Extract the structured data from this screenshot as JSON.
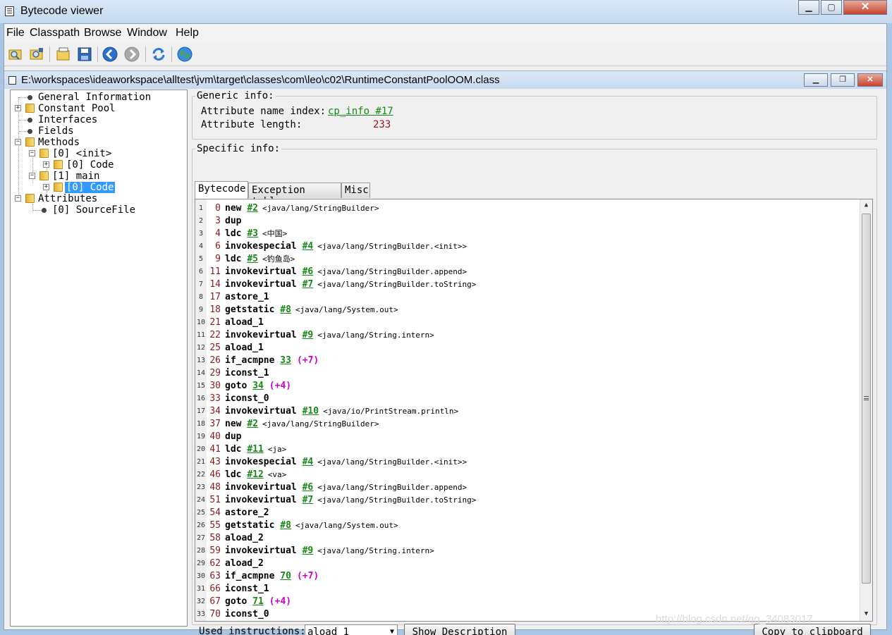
{
  "window": {
    "title": "Bytecode viewer",
    "minimize": "▁",
    "maximize": "▢",
    "close": "✕"
  },
  "menu": [
    "File",
    "Classpath",
    "Browse",
    "Window",
    "Help"
  ],
  "toolbar": {
    "icons": [
      "open-class-icon",
      "open-jar-icon",
      "browse-classpath-icon",
      "save-icon",
      "back-icon",
      "forward-icon",
      "reload-icon",
      "web-icon"
    ]
  },
  "inner_window": {
    "path": "E:\\workspaces\\ideaworkspace\\alltest\\jvm\\target\\classes\\com\\leo\\c02\\RuntimeConstantPoolOOM.class",
    "minimize": "▁",
    "restore": "❐",
    "close": "✕"
  },
  "tree": [
    {
      "label": "General Information",
      "kind": "leaf",
      "depth": 0
    },
    {
      "label": "Constant Pool",
      "kind": "folder",
      "depth": 0,
      "expanded": false
    },
    {
      "label": "Interfaces",
      "kind": "leaf",
      "depth": 0
    },
    {
      "label": "Fields",
      "kind": "leaf",
      "depth": 0
    },
    {
      "label": "Methods",
      "kind": "folder",
      "depth": 0,
      "expanded": true
    },
    {
      "label": "[0] <init>",
      "kind": "folder",
      "depth": 1,
      "expanded": true
    },
    {
      "label": "[0] Code",
      "kind": "folder",
      "depth": 2,
      "expanded": false
    },
    {
      "label": "[1] main",
      "kind": "folder",
      "depth": 1,
      "expanded": true
    },
    {
      "label": "[0] Code",
      "kind": "folder",
      "depth": 2,
      "expanded": false,
      "selected": true
    },
    {
      "label": "Attributes",
      "kind": "folder",
      "depth": 0,
      "expanded": true
    },
    {
      "label": "[0] SourceFile",
      "kind": "leaf",
      "depth": 1
    }
  ],
  "generic": {
    "title": "Generic info:",
    "name_index_label": "Attribute name index:",
    "name_index_value": "cp_info #17",
    "length_label": "Attribute length:",
    "length_value": "233"
  },
  "specific": {
    "title": "Specific info:",
    "tabs": [
      "Bytecode",
      "Exception table",
      "Misc"
    ]
  },
  "bytecode": [
    {
      "ln": "1",
      "off": "0",
      "op": "new",
      "ref": "#2",
      "cmt": "<java/lang/StringBuilder>"
    },
    {
      "ln": "2",
      "off": "3",
      "op": "dup"
    },
    {
      "ln": "3",
      "off": "4",
      "op": "ldc",
      "ref": "#3",
      "cmt": "<中国>"
    },
    {
      "ln": "4",
      "off": "6",
      "op": "invokespecial",
      "ref": "#4",
      "cmt": "<java/lang/StringBuilder.<init>>"
    },
    {
      "ln": "5",
      "off": "9",
      "op": "ldc",
      "ref": "#5",
      "cmt": "<钓鱼岛>"
    },
    {
      "ln": "6",
      "off": "11",
      "op": "invokevirtual",
      "ref": "#6",
      "cmt": "<java/lang/StringBuilder.append>"
    },
    {
      "ln": "7",
      "off": "14",
      "op": "invokevirtual",
      "ref": "#7",
      "cmt": "<java/lang/StringBuilder.toString>"
    },
    {
      "ln": "8",
      "off": "17",
      "op": "astore_1"
    },
    {
      "ln": "9",
      "off": "18",
      "op": "getstatic",
      "ref": "#8",
      "cmt": "<java/lang/System.out>"
    },
    {
      "ln": "10",
      "off": "21",
      "op": "aload_1"
    },
    {
      "ln": "11",
      "off": "22",
      "op": "invokevirtual",
      "ref": "#9",
      "cmt": "<java/lang/String.intern>"
    },
    {
      "ln": "12",
      "off": "25",
      "op": "aload_1"
    },
    {
      "ln": "13",
      "off": "26",
      "op": "if_acmpne",
      "ref": "33",
      "jmp": "(+7)"
    },
    {
      "ln": "14",
      "off": "29",
      "op": "iconst_1"
    },
    {
      "ln": "15",
      "off": "30",
      "op": "goto",
      "ref": "34",
      "jmp": "(+4)"
    },
    {
      "ln": "16",
      "off": "33",
      "op": "iconst_0"
    },
    {
      "ln": "17",
      "off": "34",
      "op": "invokevirtual",
      "ref": "#10",
      "cmt": "<java/io/PrintStream.println>"
    },
    {
      "ln": "18",
      "off": "37",
      "op": "new",
      "ref": "#2",
      "cmt": "<java/lang/StringBuilder>"
    },
    {
      "ln": "19",
      "off": "40",
      "op": "dup"
    },
    {
      "ln": "20",
      "off": "41",
      "op": "ldc",
      "ref": "#11",
      "cmt": "<ja>"
    },
    {
      "ln": "21",
      "off": "43",
      "op": "invokespecial",
      "ref": "#4",
      "cmt": "<java/lang/StringBuilder.<init>>"
    },
    {
      "ln": "22",
      "off": "46",
      "op": "ldc",
      "ref": "#12",
      "cmt": "<va>"
    },
    {
      "ln": "23",
      "off": "48",
      "op": "invokevirtual",
      "ref": "#6",
      "cmt": "<java/lang/StringBuilder.append>"
    },
    {
      "ln": "24",
      "off": "51",
      "op": "invokevirtual",
      "ref": "#7",
      "cmt": "<java/lang/StringBuilder.toString>"
    },
    {
      "ln": "25",
      "off": "54",
      "op": "astore_2"
    },
    {
      "ln": "26",
      "off": "55",
      "op": "getstatic",
      "ref": "#8",
      "cmt": "<java/lang/System.out>"
    },
    {
      "ln": "27",
      "off": "58",
      "op": "aload_2"
    },
    {
      "ln": "28",
      "off": "59",
      "op": "invokevirtual",
      "ref": "#9",
      "cmt": "<java/lang/String.intern>"
    },
    {
      "ln": "29",
      "off": "62",
      "op": "aload_2"
    },
    {
      "ln": "30",
      "off": "63",
      "op": "if_acmpne",
      "ref": "70",
      "jmp": "(+7)"
    },
    {
      "ln": "31",
      "off": "66",
      "op": "iconst_1"
    },
    {
      "ln": "32",
      "off": "67",
      "op": "goto",
      "ref": "71",
      "jmp": "(+4)"
    },
    {
      "ln": "33",
      "off": "70",
      "op": "iconst_0"
    }
  ],
  "bottom": {
    "used_label": "Used instructions:",
    "selected_instruction": "aload_1",
    "show_description": "Show Description",
    "copy": "Copy to clipboard"
  },
  "watermark": "http://blog.csdn.net/qq_34083017",
  "colors": {
    "reference": "#138a13",
    "jump": "#cc00cc",
    "offset": "#8b1a1a",
    "selection": "#3399ff",
    "length_value": "#8b1a1a"
  }
}
